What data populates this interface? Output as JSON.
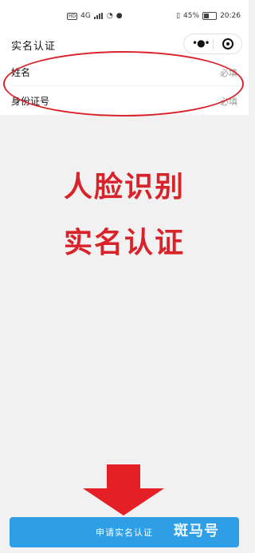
{
  "status_bar": {
    "left_badge": "HD",
    "network": "4G",
    "battery_percent": "45%",
    "time": "20:26"
  },
  "nav": {
    "title": "实名认证"
  },
  "form": {
    "rows": [
      {
        "label": "姓名",
        "placeholder": "必填"
      },
      {
        "label": "身份证号",
        "placeholder": "必填"
      }
    ]
  },
  "overlay": {
    "line1": "人脸识别",
    "line2": "实名认证"
  },
  "submit": {
    "label": "申请实名认证"
  },
  "watermark": {
    "text": "斑马号"
  },
  "colors": {
    "accent_red": "#d9232b",
    "button_blue": "#2e9fe6"
  }
}
